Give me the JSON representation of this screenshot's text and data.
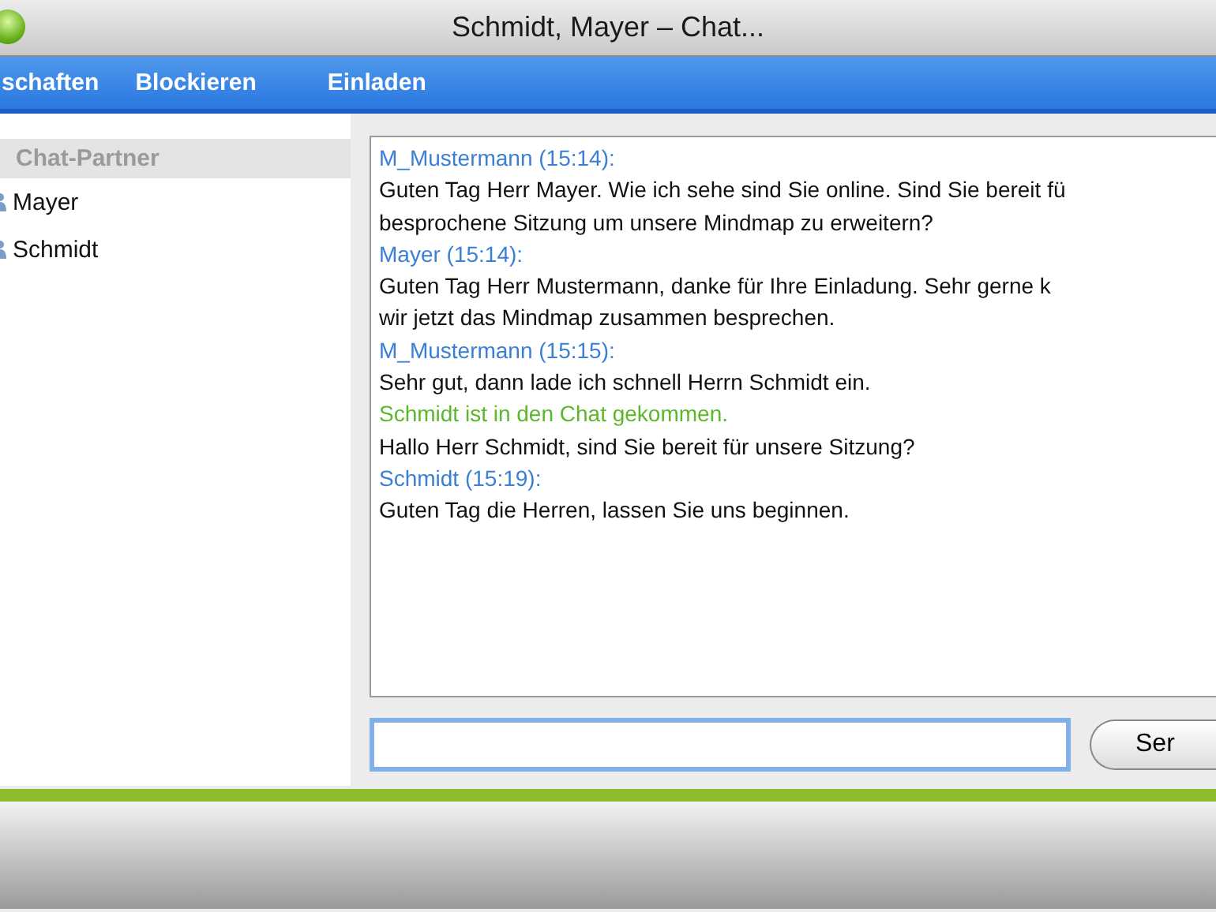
{
  "window": {
    "title": "Schmidt, Mayer – Chat..."
  },
  "toolbar": [
    "schaften",
    "Blockieren",
    "Einladen"
  ],
  "sidebar": {
    "header": "Chat-Partner",
    "items": [
      {
        "label": "Mayer"
      },
      {
        "label": "Schmidt"
      }
    ]
  },
  "chat_log": [
    {
      "kind": "sender",
      "text": "M_Mustermann (15:14):"
    },
    {
      "kind": "message",
      "text": "Guten Tag Herr Mayer. Wie ich sehe sind Sie online. Sind Sie bereit fü"
    },
    {
      "kind": "message",
      "text": "besprochene Sitzung um unsere Mindmap zu erweitern?"
    },
    {
      "kind": "sender",
      "text": "Mayer (15:14):"
    },
    {
      "kind": "message",
      "text": "Guten Tag Herr Mustermann, danke für Ihre Einladung. Sehr gerne k"
    },
    {
      "kind": "message",
      "text": "wir jetzt das Mindmap zusammen besprechen."
    },
    {
      "kind": "sender",
      "text": "M_Mustermann (15:15):"
    },
    {
      "kind": "message",
      "text": "Sehr gut, dann lade ich schnell Herrn Schmidt ein."
    },
    {
      "kind": "system",
      "text": "Schmidt ist in den Chat gekommen."
    },
    {
      "kind": "message",
      "text": "Hallo Herr Schmidt, sind Sie bereit für unsere Sitzung?"
    },
    {
      "kind": "sender",
      "text": "Schmidt (15:19):"
    },
    {
      "kind": "message",
      "text": "Guten Tag die Herren, lassen Sie uns beginnen."
    }
  ],
  "send_button": "Ser"
}
